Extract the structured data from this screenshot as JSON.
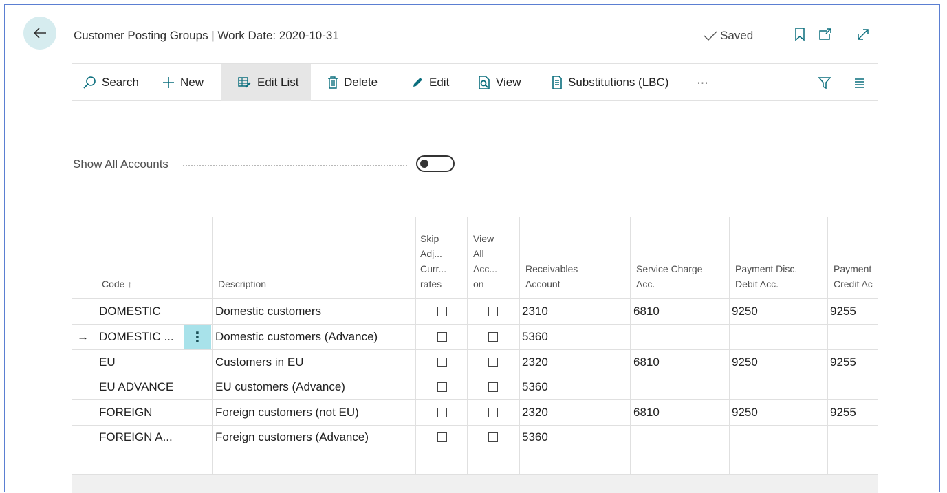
{
  "header": {
    "title": "Customer Posting Groups | Work Date: 2020-10-31",
    "saved_label": "Saved",
    "icons": [
      "back-arrow-icon",
      "bookmark-icon",
      "open-new-window-icon",
      "expand-icon"
    ]
  },
  "actions": {
    "search": "Search",
    "new": "New",
    "edit_list": "Edit List",
    "delete": "Delete",
    "edit": "Edit",
    "view": "View",
    "substitutions": "Substitutions (LBC)",
    "more": "···"
  },
  "toggle": {
    "label": "Show All Accounts",
    "value": false
  },
  "table": {
    "headers": {
      "code": "Code ↑",
      "description": "Description",
      "skip_l1": "Skip",
      "skip_l2": "Adj...",
      "skip_l3": "Curr...",
      "skip_l4": "rates",
      "view_l1": "View",
      "view_l2": "All",
      "view_l3": "Acc...",
      "view_l4": "on",
      "recv_l1": "Receivables",
      "recv_l2": "Account",
      "svc_l1": "Service Charge",
      "svc_l2": "Acc.",
      "pdd_l1": "Payment Disc.",
      "pdd_l2": "Debit Acc.",
      "pdc_l1": "Payment",
      "pdc_l2": "Credit Ac"
    },
    "rows": [
      {
        "code": "DOMESTIC",
        "description": "Domestic customers",
        "skip": false,
        "view_all": false,
        "receivables": "2310",
        "service_charge": "6810",
        "pay_disc_debit": "9250",
        "pay_disc_credit": "9255"
      },
      {
        "code": "DOMESTIC ...",
        "description": "Domestic customers (Advance)",
        "skip": false,
        "view_all": false,
        "receivables": "5360",
        "service_charge": "",
        "pay_disc_debit": "",
        "pay_disc_credit": "",
        "current": true
      },
      {
        "code": "EU",
        "description": "Customers in EU",
        "skip": false,
        "view_all": false,
        "receivables": "2320",
        "service_charge": "6810",
        "pay_disc_debit": "9250",
        "pay_disc_credit": "9255"
      },
      {
        "code": "EU ADVANCE",
        "description": "EU customers (Advance)",
        "skip": false,
        "view_all": false,
        "receivables": "5360",
        "service_charge": "",
        "pay_disc_debit": "",
        "pay_disc_credit": ""
      },
      {
        "code": "FOREIGN",
        "description": "Foreign customers (not EU)",
        "skip": false,
        "view_all": false,
        "receivables": "2320",
        "service_charge": "6810",
        "pay_disc_debit": "9250",
        "pay_disc_credit": "9255"
      },
      {
        "code": "FOREIGN A...",
        "description": "Foreign customers (Advance)",
        "skip": false,
        "view_all": false,
        "receivables": "5360",
        "service_charge": "",
        "pay_disc_debit": "",
        "pay_disc_credit": ""
      }
    ],
    "current_row_marker": "→",
    "row_menu": "⋮"
  }
}
